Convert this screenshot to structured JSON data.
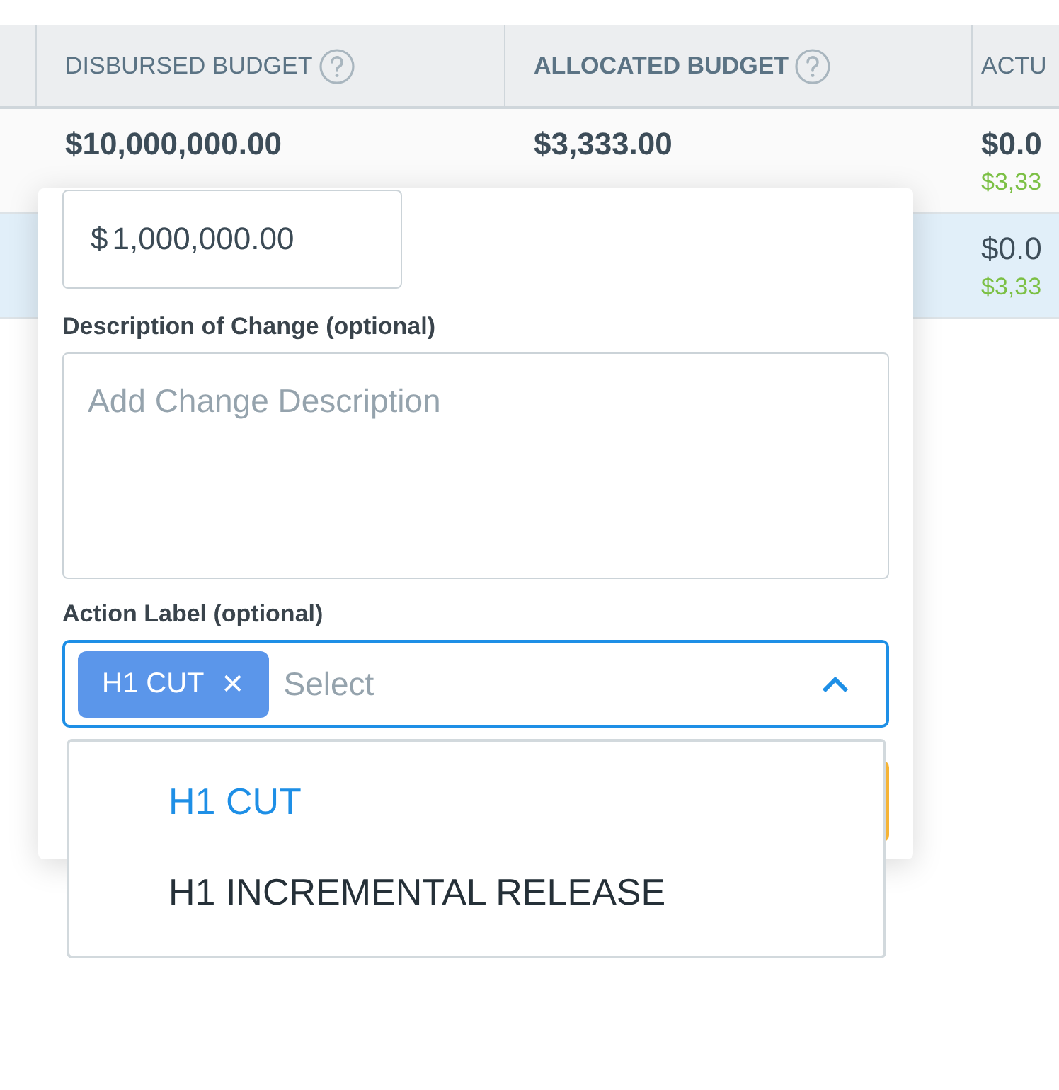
{
  "table": {
    "columns": [
      {
        "help": false
      },
      {
        "label": "DISBURSED BUDGET",
        "help": true
      },
      {
        "label": "ALLOCATED BUDGET",
        "help": true
      },
      {
        "label": "ACTU",
        "help": false
      }
    ],
    "rows": [
      {
        "selected": false,
        "cells": [
          {},
          {
            "main": "$10,000,000.00"
          },
          {
            "main": "$3,333.00"
          },
          {
            "main": "$0.0",
            "sub": "$3,33"
          }
        ]
      },
      {
        "selected": true,
        "cells": [
          {},
          {},
          {},
          {
            "main": "$0.0",
            "sub": "$3,33"
          }
        ]
      }
    ]
  },
  "editor": {
    "currency": "$",
    "amount": "1,000,000.00",
    "description_label": "Description of Change (optional)",
    "description_placeholder": "Add Change Description",
    "action_label": "Action Label (optional)",
    "tags": [
      {
        "label": "H1 CUT",
        "remove": "✕"
      }
    ],
    "select_placeholder": "Select",
    "expanded": true,
    "options": [
      {
        "label": "H1 CUT",
        "selected": true
      },
      {
        "label": "H1 INCREMENTAL RELEASE",
        "selected": false
      }
    ]
  }
}
